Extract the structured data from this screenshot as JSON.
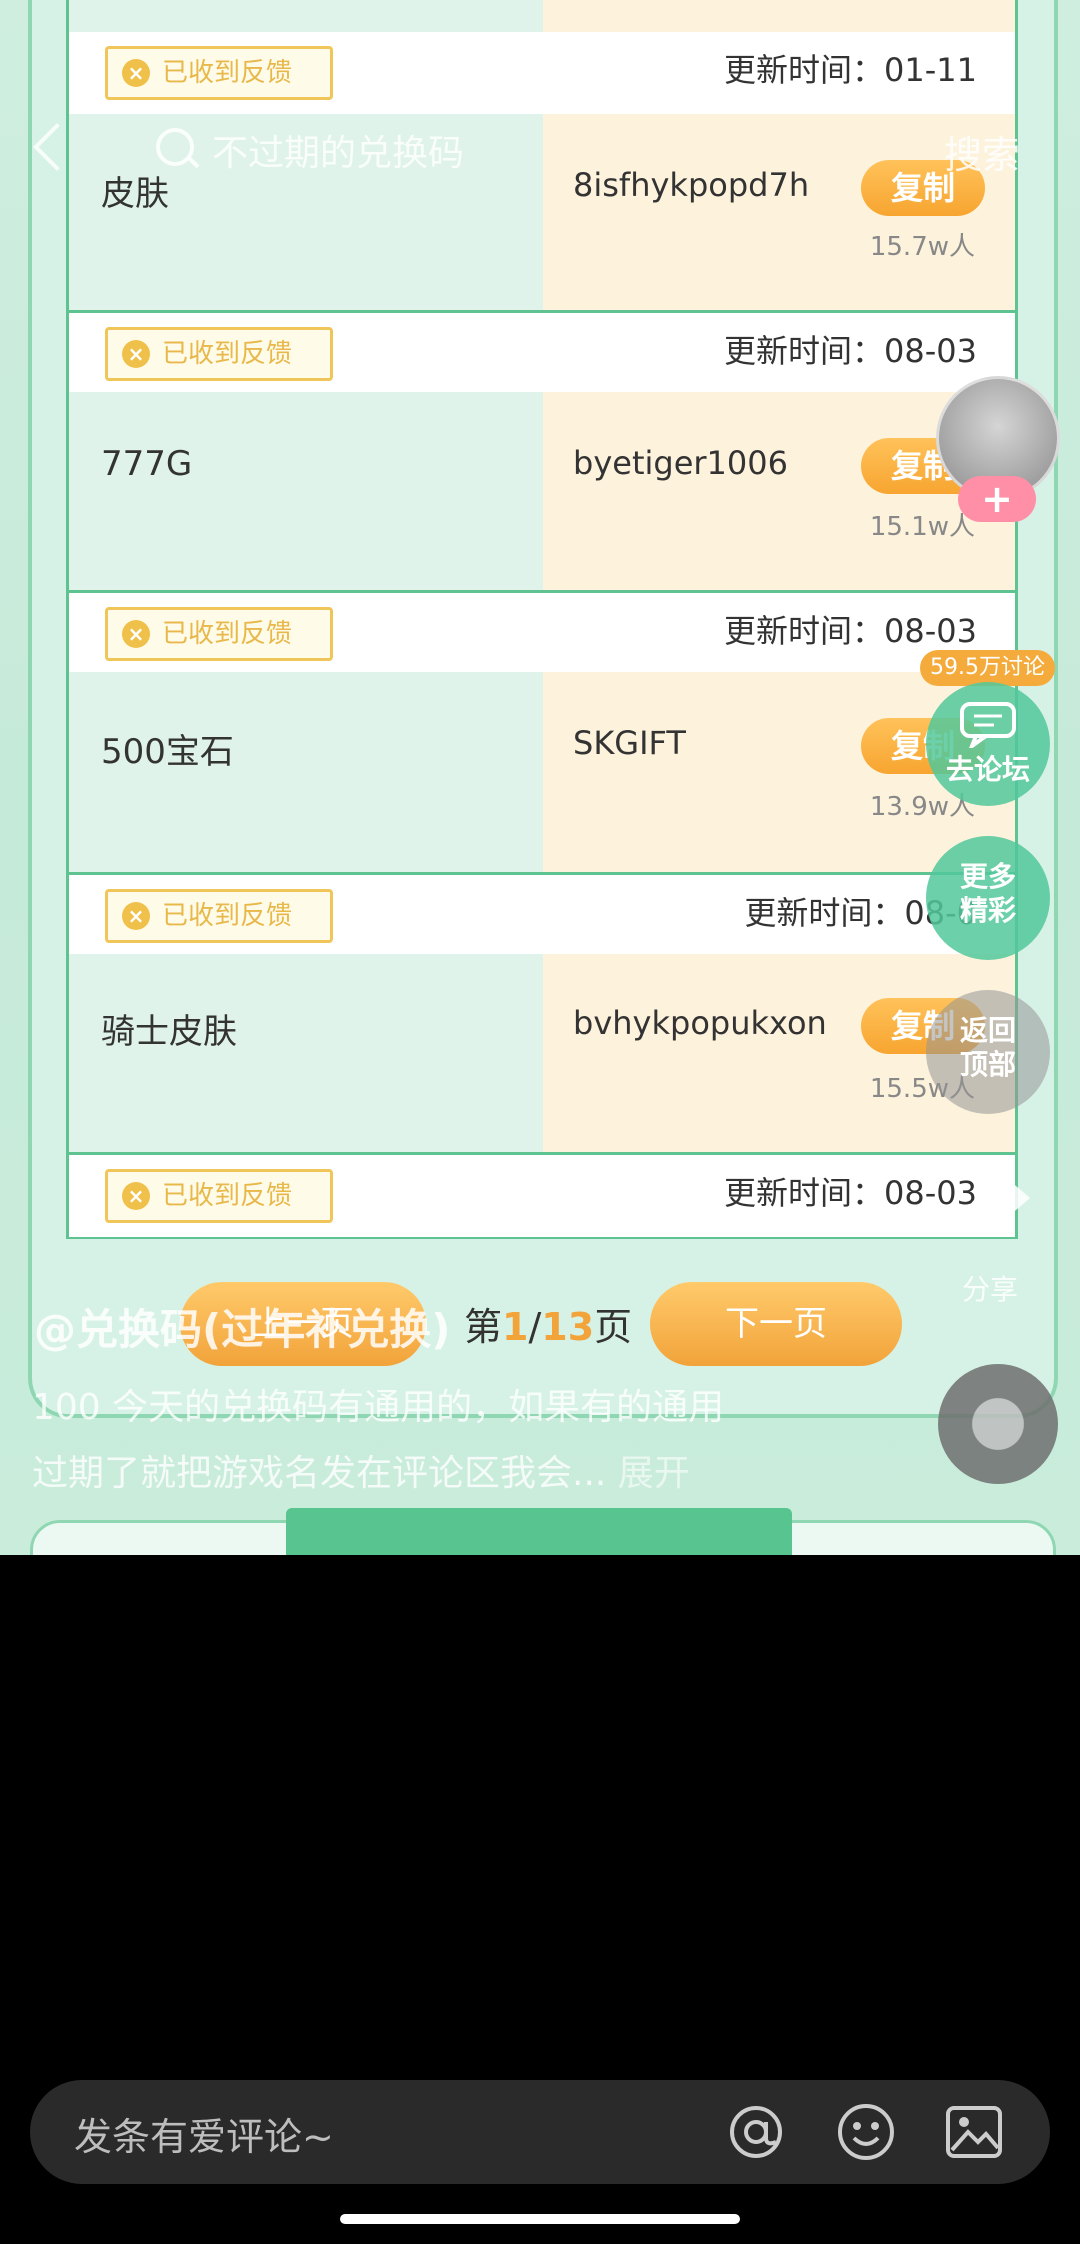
{
  "search": {
    "placeholder": "不过期的兑换码",
    "button": "搜索"
  },
  "top_partial": {
    "feedback": "已收到反馈",
    "updated": "更新时间：01-11"
  },
  "rows": [
    {
      "name": "皮肤",
      "code": "8isfhykpopd7h",
      "copy": "复制",
      "users": "15.7w人",
      "feedback": "已收到反馈",
      "updated": "更新时间：08-03"
    },
    {
      "name": "777G",
      "code": "byetiger1006",
      "copy": "复制",
      "users": "15.1w人",
      "feedback": "已收到反馈",
      "updated": "更新时间：08-03"
    },
    {
      "name": "500宝石",
      "code": "SKGIFT",
      "copy": "复制",
      "users": "13.9w人",
      "feedback": "已收到反馈",
      "updated": "更新时间：08-0"
    },
    {
      "name": "骑士皮肤",
      "code": "bvhykpopukxon",
      "copy": "复制",
      "users": "15.5w人",
      "feedback": "已收到反馈",
      "updated": "更新时间：08-03"
    }
  ],
  "rail": {
    "discussion_count": "59.5万讨论",
    "forum": "去论坛",
    "more": "更多\n精彩",
    "top": "返回\n顶部",
    "share": "分享"
  },
  "pager": {
    "prev": "上一页",
    "current": "第1/13页",
    "page": "1",
    "total": "13",
    "next": "下一页"
  },
  "post": {
    "author": "@兑换码(过年补兑换)",
    "line1": "100 今天的兑换码有通用的，如果有的通用",
    "line2": "过期了就把游戏名发在评论区我会...",
    "expand": "展开"
  },
  "comment": {
    "placeholder": "发条有爱评论~"
  },
  "icons": [
    "back-icon",
    "search-icon",
    "at-icon",
    "emoji-icon",
    "image-icon",
    "share-icon"
  ],
  "colors": {
    "accent_green": "#5fc391",
    "accent_orange": "#f2a33a",
    "feedback_yellow": "#f0c65a"
  }
}
